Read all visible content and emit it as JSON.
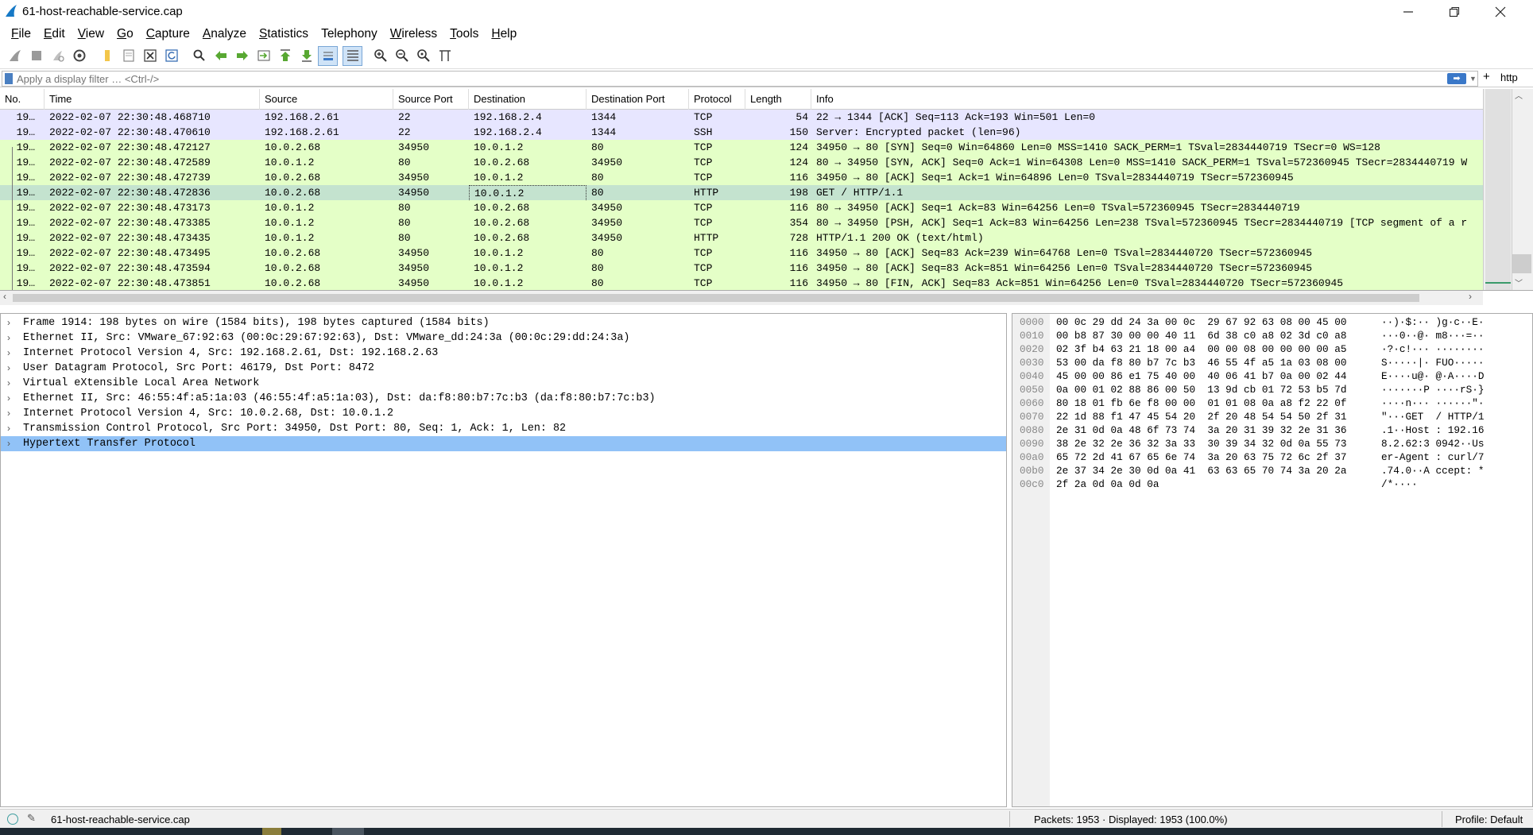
{
  "window": {
    "title": "61-host-reachable-service.cap"
  },
  "menu": [
    {
      "key": "F",
      "rest": "ile"
    },
    {
      "key": "E",
      "rest": "dit"
    },
    {
      "key": "V",
      "rest": "iew"
    },
    {
      "key": "G",
      "rest": "o"
    },
    {
      "key": "C",
      "rest": "apture"
    },
    {
      "key": "A",
      "rest": "nalyze"
    },
    {
      "key": "S",
      "rest": "tatistics"
    },
    {
      "key": "",
      "rest": "Telephony"
    },
    {
      "key": "W",
      "rest": "ireless"
    },
    {
      "key": "T",
      "rest": "ools"
    },
    {
      "key": "H",
      "rest": "elp"
    }
  ],
  "filter": {
    "placeholder": "Apply a display filter … <Ctrl-/>",
    "button_label": "http"
  },
  "packet_list": {
    "columns": [
      "No.",
      "Time",
      "Source",
      "Source Port",
      "Destination",
      "Destination Port",
      "Protocol",
      "Length",
      "Info"
    ],
    "rows": [
      {
        "no": "19…",
        "time": "2022-02-07 22:30:48.468710",
        "src": "192.168.2.61",
        "sport": "22",
        "dst": "192.168.2.4",
        "dport": "1344",
        "proto": "TCP",
        "len": "54",
        "info": "22 → 1344 [ACK] Seq=113 Ack=193 Win=501 Len=0",
        "kind": "ssh"
      },
      {
        "no": "19…",
        "time": "2022-02-07 22:30:48.470610",
        "src": "192.168.2.61",
        "sport": "22",
        "dst": "192.168.2.4",
        "dport": "1344",
        "proto": "SSH",
        "len": "150",
        "info": "Server: Encrypted packet (len=96)",
        "kind": "ssh"
      },
      {
        "no": "19…",
        "time": "2022-02-07 22:30:48.472127",
        "src": "10.0.2.68",
        "sport": "34950",
        "dst": "10.0.1.2",
        "dport": "80",
        "proto": "TCP",
        "len": "124",
        "info": "34950 → 80 [SYN] Seq=0 Win=64860 Len=0 MSS=1410 SACK_PERM=1 TSval=2834440719 TSecr=0 WS=128",
        "kind": "tcp"
      },
      {
        "no": "19…",
        "time": "2022-02-07 22:30:48.472589",
        "src": "10.0.1.2",
        "sport": "80",
        "dst": "10.0.2.68",
        "dport": "34950",
        "proto": "TCP",
        "len": "124",
        "info": "80 → 34950 [SYN, ACK] Seq=0 Ack=1 Win=64308 Len=0 MSS=1410 SACK_PERM=1 TSval=572360945 TSecr=2834440719 W",
        "kind": "tcp"
      },
      {
        "no": "19…",
        "time": "2022-02-07 22:30:48.472739",
        "src": "10.0.2.68",
        "sport": "34950",
        "dst": "10.0.1.2",
        "dport": "80",
        "proto": "TCP",
        "len": "116",
        "info": "34950 → 80 [ACK] Seq=1 Ack=1 Win=64896 Len=0 TSval=2834440719 TSecr=572360945",
        "kind": "tcp"
      },
      {
        "no": "19…",
        "time": "2022-02-07 22:30:48.472836",
        "src": "10.0.2.68",
        "sport": "34950",
        "dst": "10.0.1.2",
        "dport": "80",
        "proto": "HTTP",
        "len": "198",
        "info": "GET / HTTP/1.1",
        "kind": "sel"
      },
      {
        "no": "19…",
        "time": "2022-02-07 22:30:48.473173",
        "src": "10.0.1.2",
        "sport": "80",
        "dst": "10.0.2.68",
        "dport": "34950",
        "proto": "TCP",
        "len": "116",
        "info": "80 → 34950 [ACK] Seq=1 Ack=83 Win=64256 Len=0 TSval=572360945 TSecr=2834440719",
        "kind": "tcp"
      },
      {
        "no": "19…",
        "time": "2022-02-07 22:30:48.473385",
        "src": "10.0.1.2",
        "sport": "80",
        "dst": "10.0.2.68",
        "dport": "34950",
        "proto": "TCP",
        "len": "354",
        "info": "80 → 34950 [PSH, ACK] Seq=1 Ack=83 Win=64256 Len=238 TSval=572360945 TSecr=2834440719 [TCP segment of a r",
        "kind": "tcp"
      },
      {
        "no": "19…",
        "time": "2022-02-07 22:30:48.473435",
        "src": "10.0.1.2",
        "sport": "80",
        "dst": "10.0.2.68",
        "dport": "34950",
        "proto": "HTTP",
        "len": "728",
        "info": "HTTP/1.1 200 OK  (text/html)",
        "kind": "http"
      },
      {
        "no": "19…",
        "time": "2022-02-07 22:30:48.473495",
        "src": "10.0.2.68",
        "sport": "34950",
        "dst": "10.0.1.2",
        "dport": "80",
        "proto": "TCP",
        "len": "116",
        "info": "34950 → 80 [ACK] Seq=83 Ack=239 Win=64768 Len=0 TSval=2834440720 TSecr=572360945",
        "kind": "tcp"
      },
      {
        "no": "19…",
        "time": "2022-02-07 22:30:48.473594",
        "src": "10.0.2.68",
        "sport": "34950",
        "dst": "10.0.1.2",
        "dport": "80",
        "proto": "TCP",
        "len": "116",
        "info": "34950 → 80 [ACK] Seq=83 Ack=851 Win=64256 Len=0 TSval=2834440720 TSecr=572360945",
        "kind": "tcp"
      },
      {
        "no": "19…",
        "time": "2022-02-07 22:30:48.473851",
        "src": "10.0.2.68",
        "sport": "34950",
        "dst": "10.0.1.2",
        "dport": "80",
        "proto": "TCP",
        "len": "116",
        "info": "34950 → 80 [FIN, ACK] Seq=83 Ack=851 Win=64256 Len=0 TSval=2834440720 TSecr=572360945",
        "kind": "tcp"
      }
    ]
  },
  "details": [
    "Frame 1914: 198 bytes on wire (1584 bits), 198 bytes captured (1584 bits)",
    "Ethernet II, Src: VMware_67:92:63 (00:0c:29:67:92:63), Dst: VMware_dd:24:3a (00:0c:29:dd:24:3a)",
    "Internet Protocol Version 4, Src: 192.168.2.61, Dst: 192.168.2.63",
    "User Datagram Protocol, Src Port: 46179, Dst Port: 8472",
    "Virtual eXtensible Local Area Network",
    "Ethernet II, Src: 46:55:4f:a5:1a:03 (46:55:4f:a5:1a:03), Dst: da:f8:80:b7:7c:b3 (da:f8:80:b7:7c:b3)",
    "Internet Protocol Version 4, Src: 10.0.2.68, Dst: 10.0.1.2",
    "Transmission Control Protocol, Src Port: 34950, Dst Port: 80, Seq: 1, Ack: 1, Len: 82",
    "Hypertext Transfer Protocol"
  ],
  "hex": [
    {
      "off": "0000",
      "bytes": "00 0c 29 dd 24 3a 00 0c  29 67 92 63 08 00 45 00",
      "ascii": "··)·$:·· )g·c··E·"
    },
    {
      "off": "0010",
      "bytes": "00 b8 87 30 00 00 40 11  6d 38 c0 a8 02 3d c0 a8",
      "ascii": "···0··@· m8···=··"
    },
    {
      "off": "0020",
      "bytes": "02 3f b4 63 21 18 00 a4  00 00 08 00 00 00 00 a5",
      "ascii": "·?·c!··· ········"
    },
    {
      "off": "0030",
      "bytes": "53 00 da f8 80 b7 7c b3  46 55 4f a5 1a 03 08 00",
      "ascii": "S·····|· FUO·····"
    },
    {
      "off": "0040",
      "bytes": "45 00 00 86 e1 75 40 00  40 06 41 b7 0a 00 02 44",
      "ascii": "E····u@· @·A····D"
    },
    {
      "off": "0050",
      "bytes": "0a 00 01 02 88 86 00 50  13 9d cb 01 72 53 b5 7d",
      "ascii": "·······P ····rS·}"
    },
    {
      "off": "0060",
      "bytes": "80 18 01 fb 6e f8 00 00  01 01 08 0a a8 f2 22 0f",
      "ascii": "····n··· ······\"·"
    },
    {
      "off": "0070",
      "bytes": "22 1d 88 f1 47 45 54 20  2f 20 48 54 54 50 2f 31",
      "ascii": "\"···GET  / HTTP/1"
    },
    {
      "off": "0080",
      "bytes": "2e 31 0d 0a 48 6f 73 74  3a 20 31 39 32 2e 31 36",
      "ascii": ".1··Host : 192.16"
    },
    {
      "off": "0090",
      "bytes": "38 2e 32 2e 36 32 3a 33  30 39 34 32 0d 0a 55 73",
      "ascii": "8.2.62:3 0942··Us"
    },
    {
      "off": "00a0",
      "bytes": "65 72 2d 41 67 65 6e 74  3a 20 63 75 72 6c 2f 37",
      "ascii": "er-Agent : curl/7"
    },
    {
      "off": "00b0",
      "bytes": "2e 37 34 2e 30 0d 0a 41  63 63 65 70 74 3a 20 2a",
      "ascii": ".74.0··A ccept: *"
    },
    {
      "off": "00c0",
      "bytes": "2f 2a 0d 0a 0d 0a",
      "ascii": "/*····"
    }
  ],
  "status": {
    "file": "61-host-reachable-service.cap",
    "packets": "Packets: 1953 · Displayed: 1953 (100.0%)",
    "profile": "Profile: Default"
  }
}
